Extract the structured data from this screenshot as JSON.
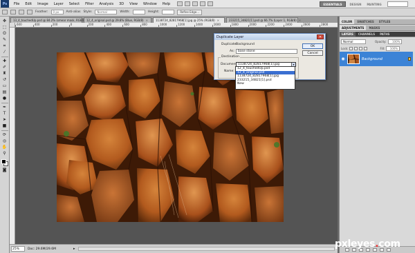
{
  "menubar": {
    "logo": "Ps",
    "items": [
      "File",
      "Edit",
      "Image",
      "Layer",
      "Select",
      "Filter",
      "Analysis",
      "3D",
      "View",
      "Window",
      "Help"
    ],
    "workspaces": {
      "essentials": "ESSENTIALS",
      "design": "DESIGN",
      "painting": "PAINTING"
    }
  },
  "options": {
    "feather_label": "Feather:",
    "feather_value": "0 px",
    "antialias_label": "Anti-alias",
    "style_label": "Style:",
    "style_value": "Normal",
    "width_label": "Width:",
    "height_label": "Height:",
    "refine_edge": "Refine Edge..."
  },
  "tabs": [
    {
      "label": "13_4_touchedUp.psd @ 84.2% (smear mask, RGB/8)",
      "active": false
    },
    {
      "label": "12_4_original.psd @ 29.8% (Blue, RGB/8)",
      "active": false
    },
    {
      "label": "1138724_82817968[1].jpg @ 25% (RGB/8)",
      "active": true
    },
    {
      "label": "233215_34821[1].psd @ 66.7% (Layer 1, RGB/8)",
      "active": false
    }
  ],
  "ruler": {
    "top": [
      "600",
      "400",
      "200",
      "0",
      "200",
      "400",
      "600",
      "800",
      "1000",
      "1200",
      "1400",
      "1600",
      "1800",
      "2000",
      "2200",
      "2400",
      "2600",
      "2800"
    ]
  },
  "status": {
    "zoom": "25%",
    "doc": "Doc: 29.6M/29.6M"
  },
  "panels": {
    "row1": [
      "COLOR",
      "SWATCHES",
      "STYLES"
    ],
    "row2": [
      "ADJUSTMENTS",
      "MASKS"
    ],
    "row3": [
      "LAYERS",
      "CHANNELS",
      "PATHS"
    ],
    "blend_mode": "Normal",
    "opacity_label": "Opacity:",
    "opacity_value": "100%",
    "lock_label": "Lock:",
    "fill_label": "Fill:",
    "fill_value": "100%",
    "layer_name": "Background"
  },
  "dialog": {
    "title": "Duplicate Layer",
    "close": "✕",
    "duplicate_label": "Duplicate:",
    "duplicate_value": "Background",
    "as_label": "As:",
    "as_value": "base stone",
    "group_label": "Destination",
    "document_label": "Document:",
    "document_value": "1138724_82817968[1].jpg",
    "name_label": "Name:",
    "ok": "OK",
    "cancel": "Cancel",
    "options": [
      {
        "label": "12_4_touchedUp.psd",
        "selected": false
      },
      {
        "label": "12_4_original.psd",
        "selected": true
      },
      {
        "label": "1138724_82817968[1].jpg",
        "selected": false
      },
      {
        "label": "233215_34821[1].psd",
        "selected": false
      },
      {
        "label": "New",
        "selected": false
      }
    ]
  },
  "watermark": {
    "main": "pxleyes",
    "dot": ".",
    "suffix": "com"
  },
  "colors": {
    "selection": "#3a6fd1",
    "layer_selected": "#3c83d6",
    "canvas_bg": "#545454"
  },
  "icons": [
    "ps-logo-icon",
    "move-tool-icon",
    "marquee-tool-icon",
    "lasso-tool-icon",
    "quick-select-icon",
    "crop-tool-icon",
    "eyedropper-icon",
    "healing-brush-icon",
    "brush-icon",
    "clone-stamp-icon",
    "history-brush-icon",
    "eraser-icon",
    "gradient-icon",
    "dodge-icon",
    "pen-icon",
    "type-icon",
    "path-select-icon",
    "shape-icon",
    "hand-icon",
    "zoom-icon",
    "eye-icon",
    "lock-icon"
  ]
}
